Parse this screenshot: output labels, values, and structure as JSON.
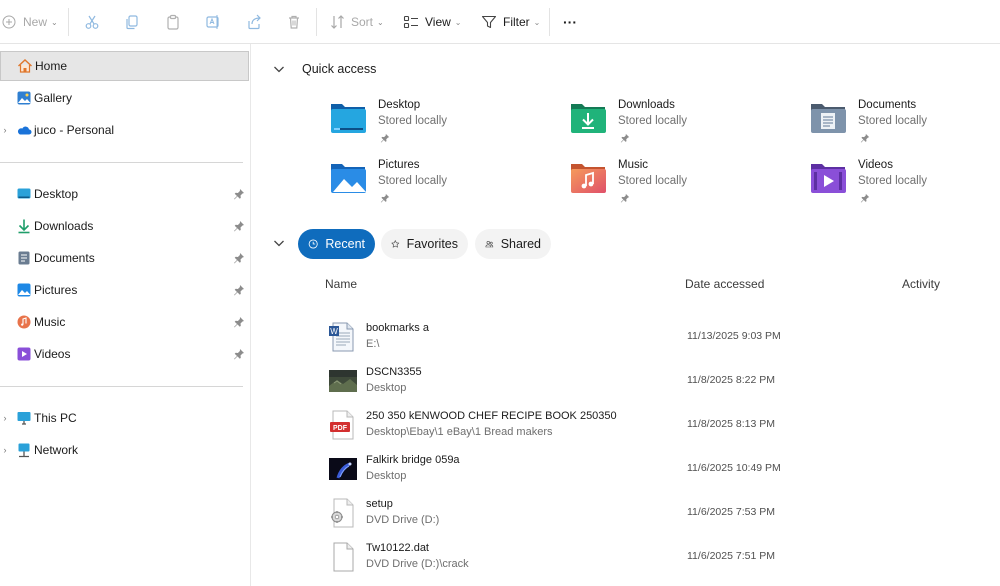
{
  "toolbar": {
    "new_label": "New",
    "sort_label": "Sort",
    "view_label": "View",
    "filter_label": "Filter",
    "more_label": "···",
    "icons": [
      "new-icon",
      "cut-icon",
      "copy-icon",
      "paste-icon",
      "rename-icon",
      "share-icon",
      "delete-icon",
      "sort-icon",
      "view-icon",
      "filter-icon",
      "more-icon"
    ]
  },
  "sidebar": {
    "top_items": [
      {
        "label": "Home",
        "icon": "home-icon",
        "selected": true
      },
      {
        "label": "Gallery",
        "icon": "gallery-icon"
      },
      {
        "label": "juco - Personal",
        "icon": "onedrive-icon",
        "expandable": true
      }
    ],
    "pinned_items": [
      {
        "label": "Desktop",
        "icon": "desktop-icon"
      },
      {
        "label": "Downloads",
        "icon": "downloads-icon"
      },
      {
        "label": "Documents",
        "icon": "documents-icon"
      },
      {
        "label": "Pictures",
        "icon": "pictures-icon"
      },
      {
        "label": "Music",
        "icon": "music-icon"
      },
      {
        "label": "Videos",
        "icon": "videos-icon"
      }
    ],
    "bottom_items": [
      {
        "label": "This PC",
        "icon": "this-pc-icon",
        "expandable": true
      },
      {
        "label": "Network",
        "icon": "network-icon",
        "expandable": true
      }
    ]
  },
  "quick_access": {
    "title": "Quick access",
    "items": [
      {
        "name": "Desktop",
        "sub": "Stored locally",
        "icon": "desktop-folder-icon"
      },
      {
        "name": "Downloads",
        "sub": "Stored locally",
        "icon": "downloads-folder-icon"
      },
      {
        "name": "Documents",
        "sub": "Stored locally",
        "icon": "documents-folder-icon"
      },
      {
        "name": "Pictures",
        "sub": "Stored locally",
        "icon": "pictures-folder-icon"
      },
      {
        "name": "Music",
        "sub": "Stored locally",
        "icon": "music-folder-icon"
      },
      {
        "name": "Videos",
        "sub": "Stored locally",
        "icon": "videos-folder-icon"
      }
    ]
  },
  "recent": {
    "tabs": [
      {
        "label": "Recent",
        "active": true
      },
      {
        "label": "Favorites"
      },
      {
        "label": "Shared"
      }
    ],
    "columns": {
      "name": "Name",
      "date": "Date accessed",
      "activity": "Activity"
    },
    "files": [
      {
        "name": "bookmarks  a",
        "path": "E:\\",
        "date": "11/13/2025 9:03 PM",
        "icon": "word-document-icon"
      },
      {
        "name": "DSCN3355",
        "path": "Desktop",
        "date": "11/8/2025 8:22 PM",
        "icon": "photo-thumbnail-icon"
      },
      {
        "name": "250  350 kENWOOD CHEF RECIPE BOOK 250350",
        "path": "Desktop\\Ebay\\1 eBay\\1 Bread makers",
        "date": "11/8/2025 8:13 PM",
        "icon": "pdf-icon"
      },
      {
        "name": "Falkirk bridge 059a",
        "path": "Desktop",
        "date": "11/6/2025 10:49 PM",
        "icon": "night-photo-thumbnail-icon"
      },
      {
        "name": "setup",
        "path": "DVD Drive (D:)",
        "date": "11/6/2025 7:53 PM",
        "icon": "setup-file-icon"
      },
      {
        "name": "Tw10122.dat",
        "path": "DVD Drive (D:)\\crack",
        "date": "11/6/2025 7:51 PM",
        "icon": "blank-file-icon"
      }
    ]
  },
  "colors": {
    "accent": "#0f6cbd",
    "selection_bg": "#e6e6e6",
    "pdf_red": "#d32f2f"
  }
}
